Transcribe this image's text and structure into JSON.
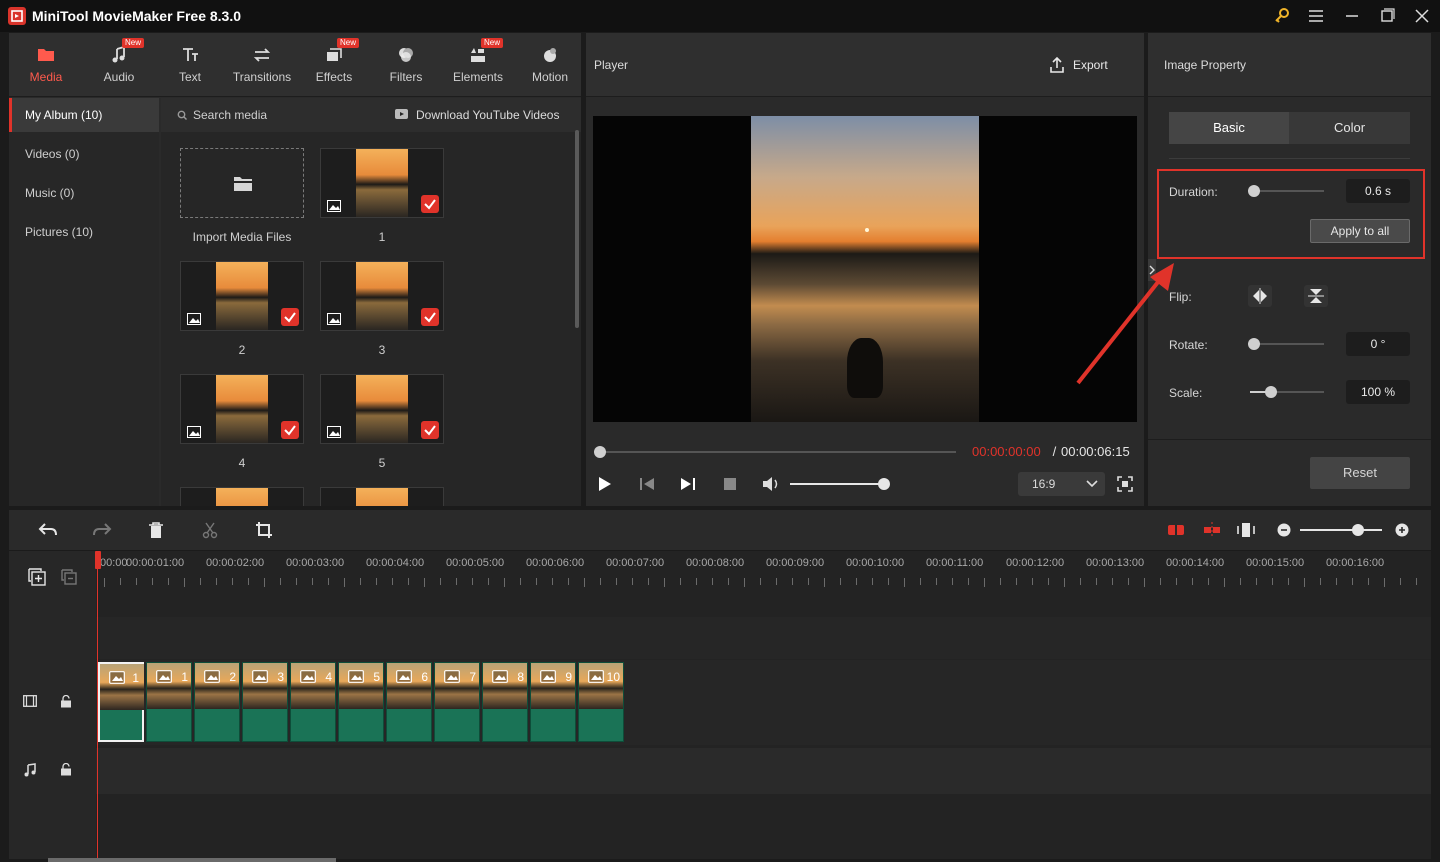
{
  "app": {
    "title": "MiniTool MovieMaker Free 8.3.0"
  },
  "toolbar": {
    "items": [
      {
        "label": "Media",
        "icon": "media-folder-icon",
        "new": false,
        "active": true
      },
      {
        "label": "Audio",
        "icon": "music-note-icon",
        "new": true
      },
      {
        "label": "Text",
        "icon": "text-icon",
        "new": false
      },
      {
        "label": "Transitions",
        "icon": "transitions-icon",
        "new": false
      },
      {
        "label": "Effects",
        "icon": "effects-icon",
        "new": true
      },
      {
        "label": "Filters",
        "icon": "filters-icon",
        "new": false
      },
      {
        "label": "Elements",
        "icon": "elements-icon",
        "new": true
      },
      {
        "label": "Motion",
        "icon": "motion-icon",
        "new": false
      }
    ],
    "new_badge": "New"
  },
  "album": {
    "items": [
      {
        "label": "My Album (10)",
        "active": true
      },
      {
        "label": "Videos (0)"
      },
      {
        "label": "Music (0)"
      },
      {
        "label": "Pictures (10)"
      }
    ]
  },
  "media": {
    "search_placeholder": "Search media",
    "download_label": "Download YouTube Videos",
    "import_label": "Import Media Files",
    "items": [
      "1",
      "2",
      "3",
      "4",
      "5"
    ]
  },
  "player": {
    "title": "Player",
    "export_label": "Export",
    "current_time": "00:00:00:00",
    "separator": " / ",
    "total_time": "00:00:06:15",
    "aspect_ratio": "16:9"
  },
  "property": {
    "title": "Image Property",
    "tabs": [
      "Basic",
      "Color"
    ],
    "duration_label": "Duration:",
    "duration_value": "0.6 s",
    "apply_all_label": "Apply to all",
    "flip_label": "Flip:",
    "rotate_label": "Rotate:",
    "rotate_value": "0 °",
    "scale_label": "Scale:",
    "scale_value": "100 %",
    "reset_label": "Reset"
  },
  "timeline": {
    "ruler": [
      "00:00",
      "00:00:01:00",
      "00:00:02:00",
      "00:00:03:00",
      "00:00:04:00",
      "00:00:05:00",
      "00:00:06:00",
      "00:00:07:00",
      "00:00:08:00",
      "00:00:09:00",
      "00:00:10:00",
      "00:00:11:00",
      "00:00:12:00",
      "00:00:13:00",
      "00:00:14:00",
      "00:00:15:00",
      "00:00:16:00"
    ],
    "clips": [
      "1",
      "1",
      "2",
      "3",
      "4",
      "5",
      "6",
      "7",
      "8",
      "9",
      "10"
    ]
  },
  "colors": {
    "accent": "#e0332a",
    "clip_green": "#1a7356",
    "panel": "#2a2a2a"
  }
}
